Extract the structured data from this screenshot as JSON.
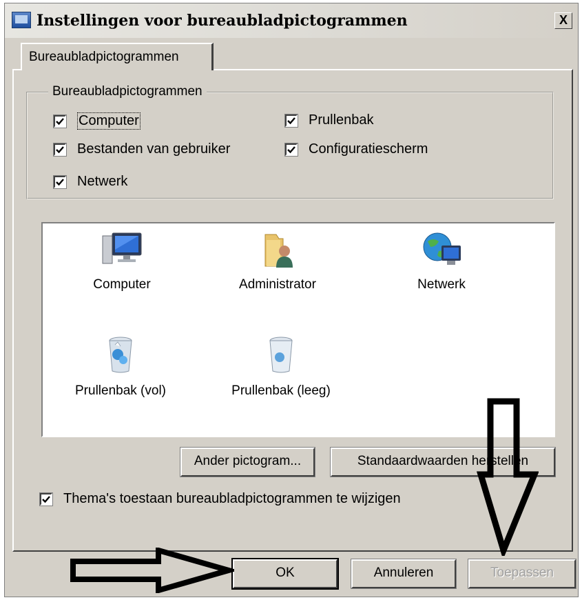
{
  "window": {
    "title": "Instellingen voor bureaubladpictogrammen",
    "close_label": "X"
  },
  "tabs": [
    {
      "label": "Bureaubladpictogrammen",
      "active": true
    }
  ],
  "group": {
    "legend": "Bureaubladpictogrammen",
    "checkboxes": [
      {
        "label": "Computer",
        "checked": true
      },
      {
        "label": "Prullenbak",
        "checked": true
      },
      {
        "label": "Bestanden van gebruiker",
        "checked": true
      },
      {
        "label": "Configuratiescherm",
        "checked": true
      },
      {
        "label": "Netwerk",
        "checked": true
      }
    ]
  },
  "preview": {
    "icons": [
      {
        "label": "Computer",
        "icon": "computer-icon"
      },
      {
        "label": "Administrator",
        "icon": "user-folder-icon"
      },
      {
        "label": "Netwerk",
        "icon": "network-icon"
      },
      {
        "label": "Prullenbak (vol)",
        "icon": "recycle-bin-full-icon"
      },
      {
        "label": "Prullenbak (leeg)",
        "icon": "recycle-bin-empty-icon"
      }
    ]
  },
  "buttons": {
    "change_icon": "Ander pictogram...",
    "restore_default": "Standaardwaarden herstellen",
    "ok": "OK",
    "cancel": "Annuleren",
    "apply": "Toepassen"
  },
  "theme_checkbox": {
    "label": "Thema's toestaan bureaubladpictogrammen te wijzigen",
    "checked": true
  },
  "colors": {
    "dialog_bg": "#d4d0c8",
    "arrow": "#000000"
  }
}
